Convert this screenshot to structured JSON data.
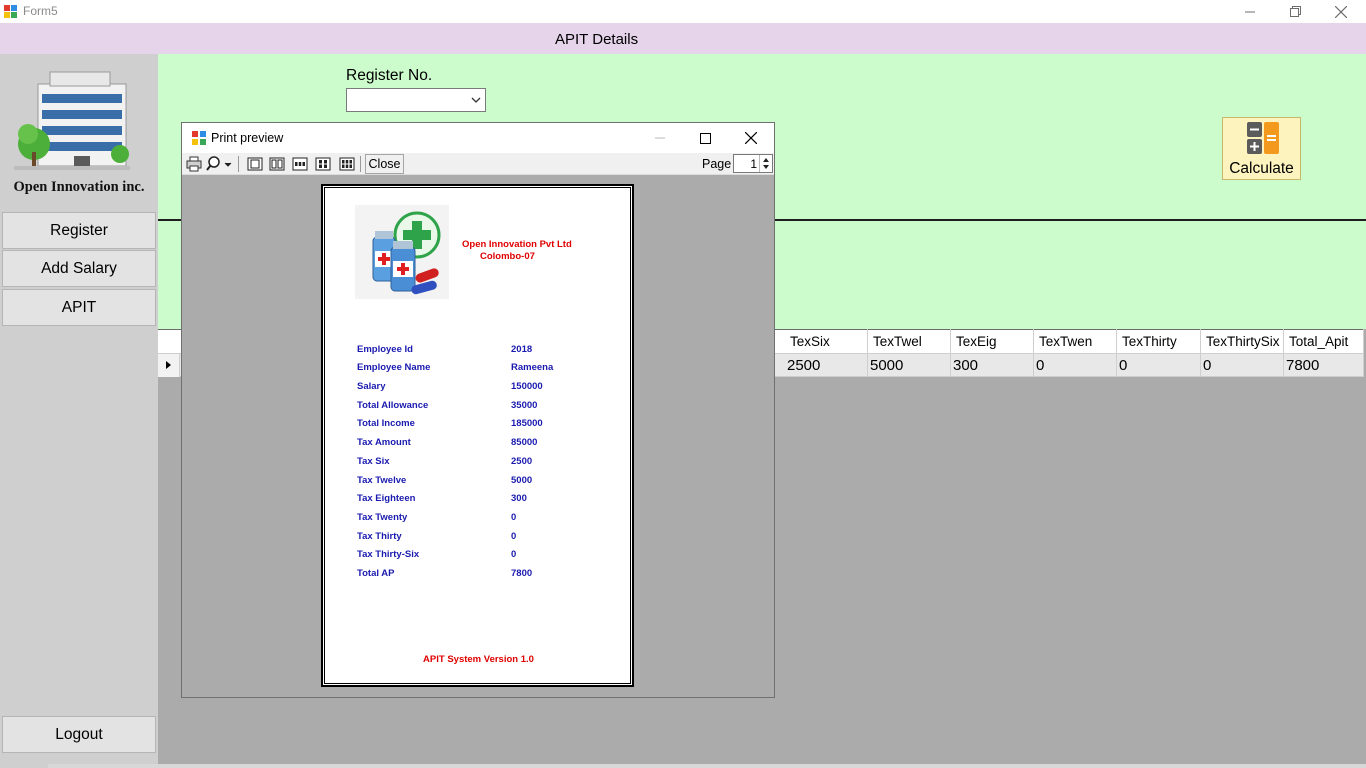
{
  "window": {
    "title": "Form5"
  },
  "header": {
    "title": "APIT Details"
  },
  "sidebar": {
    "company": "Open Innovation inc.",
    "items": [
      {
        "label": "Register"
      },
      {
        "label": "Add Salary"
      },
      {
        "label": "APIT"
      }
    ],
    "logout": "Logout"
  },
  "form": {
    "register_label": "Register No.",
    "register_value": "",
    "calculate_label": "Calculate"
  },
  "grid": {
    "columns": [
      "TexSix",
      "TexTwel",
      "TexEig",
      "TexTwen",
      "TexThirty",
      "TexThirtySix",
      "Total_Apit"
    ],
    "rows": [
      [
        "2500",
        "5000",
        "300",
        "0",
        "0",
        "0",
        "7800"
      ]
    ]
  },
  "print_preview": {
    "title": "Print preview",
    "close_label": "Close",
    "page_label": "Page",
    "page_value": "1",
    "report": {
      "company_name": "Open Innovation Pvt Ltd",
      "company_city": "Colombo-07",
      "fields": [
        {
          "label": "Employee Id",
          "value": "2018"
        },
        {
          "label": "Employee Name",
          "value": "Rameena"
        },
        {
          "label": "Salary",
          "value": "150000"
        },
        {
          "label": "Total Allowance",
          "value": "35000"
        },
        {
          "label": "Total Income",
          "value": "185000"
        },
        {
          "label": "Tax Amount",
          "value": "85000"
        },
        {
          "label": "Tax Six",
          "value": "2500"
        },
        {
          "label": "Tax Twelve",
          "value": "5000"
        },
        {
          "label": "Tax Eighteen",
          "value": "300"
        },
        {
          "label": "Tax Twenty",
          "value": "0"
        },
        {
          "label": "Tax Thirty",
          "value": "0"
        },
        {
          "label": "Tax Thirty-Six",
          "value": "0"
        },
        {
          "label": "Total AP",
          "value": "7800"
        }
      ],
      "footer": "APIT System Version 1.0"
    }
  },
  "colors": {
    "header_band": "#e6d4ea",
    "main_area": "#ccfccc",
    "sidebar": "#cfcfcf",
    "report_label": "#1a1ab0",
    "report_accent": "#e00000"
  }
}
